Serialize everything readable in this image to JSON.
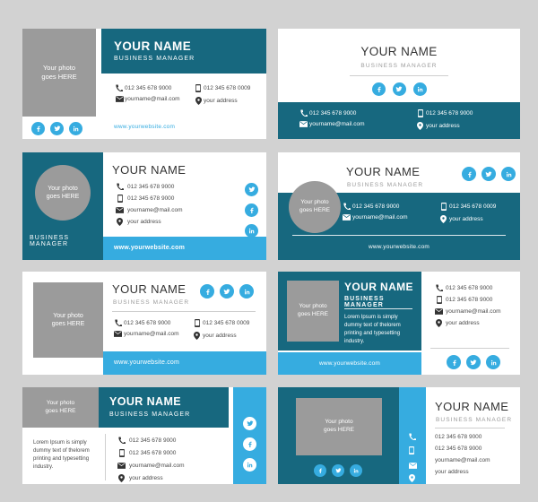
{
  "palette": {
    "background": "#d2d2d2",
    "teal": "#17687f",
    "light_blue": "#36ace0",
    "photo_gray": "#9b9b9b",
    "card_white": "#ffffff",
    "text_dark": "#333333",
    "text_muted": "#9a9a9a"
  },
  "common": {
    "name": "YOUR NAME",
    "role": "BUSINESS MANAGER",
    "photo_line1": "Your photo",
    "photo_line2": "goes HERE",
    "phone": "012 345 678 9000",
    "mobile": "012 345 678 9000",
    "mobile_alt": "012 345 678 0009",
    "email": "yourname@mail.com",
    "address": "your address",
    "website": "www.yourwebsite.com",
    "lorem": "Lorem Ipsum is simply dummy text of thelorem printing and typesetting industry.",
    "icons": {
      "phone": "phone-icon",
      "mobile": "mobile-icon",
      "email": "email-icon",
      "address": "location-pin-icon",
      "facebook": "facebook-icon",
      "twitter": "twitter-icon",
      "linkedin": "linkedin-icon"
    }
  },
  "cards": [
    {
      "id": "card-1",
      "layout": "photo-left-teal-header",
      "name": "YOUR NAME",
      "role": "BUSINESS MANAGER",
      "photo_line1": "Your photo",
      "photo_line2": "goes HERE",
      "phone": "012 345 678 9000",
      "mobile": "012 345 678 0009",
      "email": "yourname@mail.com",
      "address": "your address",
      "website": "www.yourwebsite.com",
      "social": [
        "facebook",
        "twitter",
        "linkedin"
      ]
    },
    {
      "id": "card-2",
      "layout": "centered-teal-footer",
      "name": "YOUR NAME",
      "role": "BUSINESS MANAGER",
      "phone": "012 345 678 9000",
      "mobile": "012 345 678 9000",
      "email": "yourname@mail.com",
      "address": "your address",
      "social": [
        "facebook",
        "twitter",
        "linkedin"
      ]
    },
    {
      "id": "card-3",
      "layout": "teal-panel-circle-photo",
      "name": "YOUR NAME",
      "role": "BUSINESS MANAGER",
      "photo_line1": "Your photo",
      "photo_line2": "goes HERE",
      "phone": "012 345 678 9000",
      "mobile": "012 345 678 9000",
      "email": "yourname@mail.com",
      "address": "your address",
      "website": "www.yourwebsite.com",
      "social": [
        "twitter",
        "facebook",
        "linkedin"
      ]
    },
    {
      "id": "card-4",
      "layout": "circle-photo-overlap-teal",
      "name": "YOUR NAME",
      "role": "BUSINESS MANAGER",
      "photo_line1": "Your photo",
      "photo_line2": "goes HERE",
      "phone": "012 345 678 9000",
      "mobile": "012 345 678 0009",
      "email": "yourname@mail.com",
      "address": "your address",
      "website": "www.yourwebsite.com",
      "social": [
        "facebook",
        "twitter",
        "linkedin"
      ]
    },
    {
      "id": "card-5",
      "layout": "square-photo-white-blue-footer",
      "name": "YOUR NAME",
      "role": "BUSINESS MANAGER",
      "photo_line1": "Your photo",
      "photo_line2": "goes HERE",
      "phone": "012 345 678 9000",
      "mobile": "012 345 678 0009",
      "email": "yourname@mail.com",
      "address": "your address",
      "website": "www.yourwebsite.com",
      "social": [
        "facebook",
        "twitter",
        "linkedin"
      ]
    },
    {
      "id": "card-6",
      "layout": "teal-left-lorem-white-right",
      "name": "YOUR NAME",
      "role": "BUSINESS MANAGER",
      "photo_line1": "Your photo",
      "photo_line2": "goes HERE",
      "lorem": "Lorem Ipsum is simply dummy text of thelorem printing and typesetting industry.",
      "phone": "012 345 678 9000",
      "mobile": "012 345 678 9000",
      "email": "yourname@mail.com",
      "address": "your address",
      "website": "www.yourwebsite.com",
      "social": [
        "facebook",
        "twitter",
        "linkedin"
      ]
    },
    {
      "id": "card-7",
      "layout": "teal-header-lorem-left-blue-rail",
      "name": "YOUR NAME",
      "role": "BUSINESS MANAGER",
      "photo_line1": "Your photo",
      "photo_line2": "goes HERE",
      "lorem": "Lorem Ipsum is simply dummy text of thelorem printing and typesetting industry.",
      "phone": "012 345 678 9000",
      "mobile": "012 345 678 9000",
      "email": "yourname@mail.com",
      "address": "your address",
      "social": [
        "twitter",
        "facebook",
        "linkedin"
      ]
    },
    {
      "id": "card-8",
      "layout": "teal-photo-left-blue-rail-white-right",
      "name": "YOUR NAME",
      "role": "BUSINESS MANAGER",
      "photo_line1": "Your photo",
      "photo_line2": "goes HERE",
      "phone": "012 345 678 9000",
      "mobile": "012 345 678 9000",
      "email": "yourname@mail.com",
      "address": "your address",
      "social": [
        "facebook",
        "twitter",
        "linkedin"
      ]
    }
  ]
}
